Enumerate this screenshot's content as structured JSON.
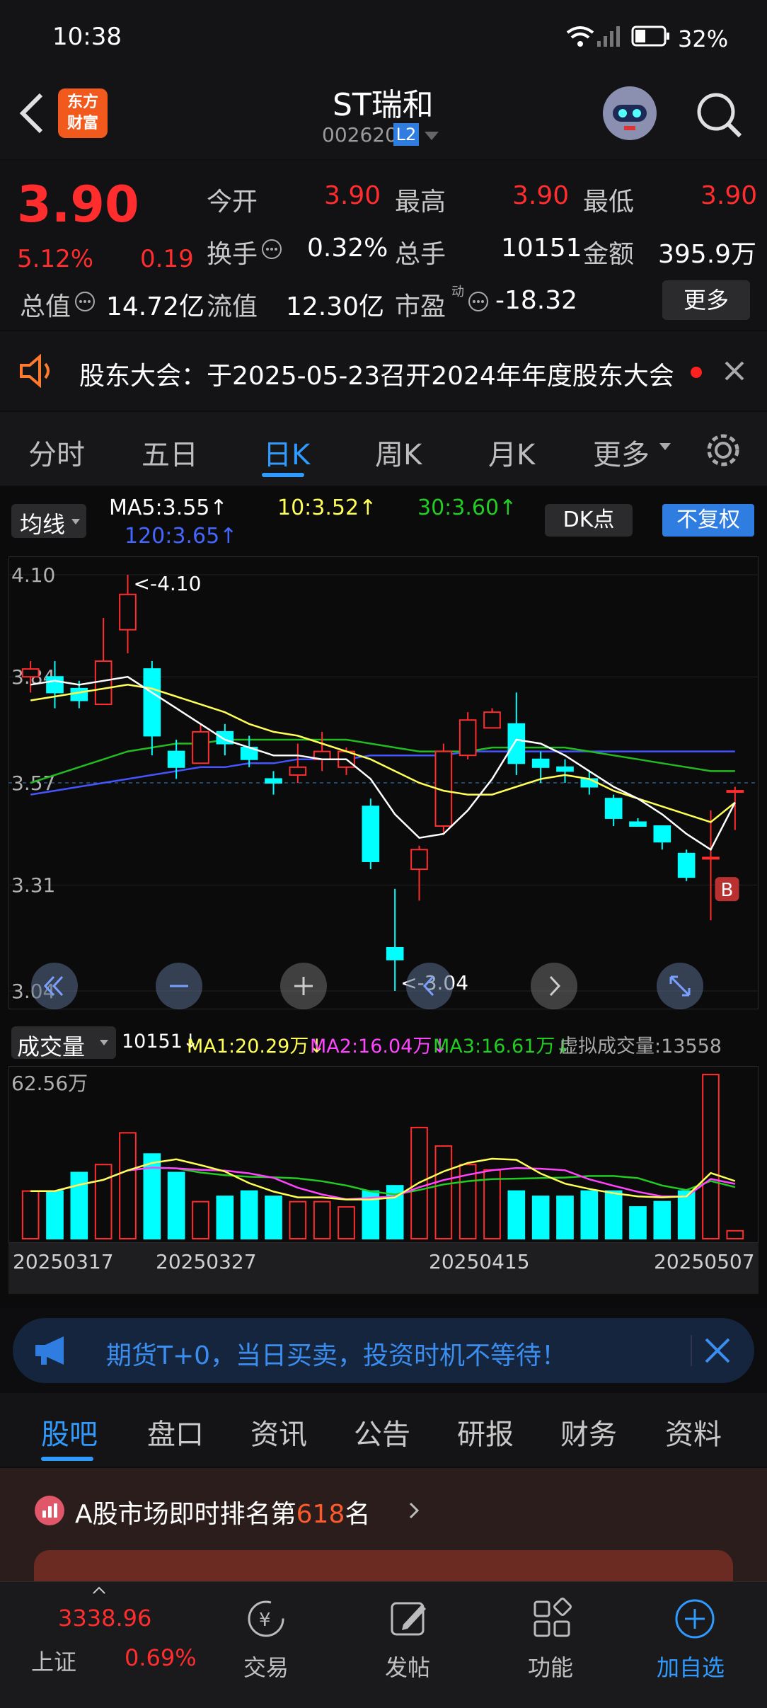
{
  "status": {
    "time": "10:38",
    "battery": "32%"
  },
  "header": {
    "title": "ST瑞和",
    "code": "002620",
    "level": "L2",
    "logo_line1": "东方",
    "logo_line2": "财富"
  },
  "quote": {
    "price": "3.90",
    "change_pct": "5.12%",
    "change_amt": "0.19",
    "open_label": "今开",
    "open": "3.90",
    "high_label": "最高",
    "high": "3.90",
    "low_label": "最低",
    "low": "3.90",
    "turnover_label": "换手",
    "turnover": "0.32%",
    "volume_label": "总手",
    "volume": "10151",
    "amount_label": "金额",
    "amount": "395.9万",
    "mktcap_label": "总值",
    "mktcap": "14.72亿",
    "float_label": "流值",
    "float": "12.30亿",
    "pe_label": "市盈",
    "pe_sup": "动",
    "pe": "-18.32",
    "more_button": "更多"
  },
  "notice": {
    "text": "股东大会：于2025-05-23召开2024年年度股东大会"
  },
  "ktabs": [
    "分时",
    "五日",
    "日K",
    "周K",
    "月K",
    "更多"
  ],
  "ktabs_active": 2,
  "ma_bar": {
    "selector": "均线",
    "ma5": "MA5:3.55↑",
    "ma10": "10:3.52↑",
    "ma30": "30:3.60↑",
    "ma120": "120:3.65↑",
    "dk": "DK点",
    "fq": "不复权"
  },
  "chart_labels": {
    "y_ticks": [
      "4.10",
      "3.84",
      "3.57",
      "3.31",
      "3.04"
    ],
    "high_mark": "<-4.10",
    "low_mark": "<-3.04",
    "b_marker": "B"
  },
  "vol_bar": {
    "selector": "成交量",
    "vol": "10151↓",
    "ma1": "MA1:20.29万↓",
    "ma2": "MA2:16.04万↓",
    "ma3": "MA3:16.61万↓",
    "virtual": "虚拟成交量:13558",
    "top": "62.56万"
  },
  "dates": [
    "20250317",
    "20250327",
    "20250415",
    "20250507"
  ],
  "colors": {
    "up": "#ff2d2d",
    "down": "#00ffff",
    "ma5": "#ffffff",
    "ma10": "#ffff55",
    "ma30": "#22bb22",
    "ma120": "#4455ff",
    "accent": "#2f7de1"
  },
  "chart_data": {
    "type": "candlestick",
    "dates_shown": [
      "20250317",
      "20250327",
      "20250415",
      "20250507"
    ],
    "candles": [
      {
        "o": 3.84,
        "c": 3.86,
        "h": 3.88,
        "l": 3.8
      },
      {
        "o": 3.84,
        "c": 3.8,
        "h": 3.88,
        "l": 3.76
      },
      {
        "o": 3.81,
        "c": 3.78,
        "h": 3.83,
        "l": 3.76
      },
      {
        "o": 3.77,
        "c": 3.88,
        "h": 3.99,
        "l": 3.77
      },
      {
        "o": 3.96,
        "c": 4.05,
        "h": 4.1,
        "l": 3.9
      },
      {
        "o": 3.86,
        "c": 3.69,
        "h": 3.88,
        "l": 3.64
      },
      {
        "o": 3.65,
        "c": 3.61,
        "h": 3.68,
        "l": 3.58
      },
      {
        "o": 3.62,
        "c": 3.7,
        "h": 3.72,
        "l": 3.62
      },
      {
        "o": 3.7,
        "c": 3.67,
        "h": 3.72,
        "l": 3.64
      },
      {
        "o": 3.66,
        "c": 3.63,
        "h": 3.69,
        "l": 3.61
      },
      {
        "o": 3.58,
        "c": 3.57,
        "h": 3.6,
        "l": 3.54
      },
      {
        "o": 3.59,
        "c": 3.61,
        "h": 3.67,
        "l": 3.57
      },
      {
        "o": 3.63,
        "c": 3.65,
        "h": 3.7,
        "l": 3.6
      },
      {
        "o": 3.61,
        "c": 3.65,
        "h": 3.66,
        "l": 3.59
      },
      {
        "o": 3.51,
        "c": 3.37,
        "h": 3.53,
        "l": 3.35
      },
      {
        "o": 3.15,
        "c": 3.12,
        "h": 3.3,
        "l": 3.04
      },
      {
        "o": 3.35,
        "c": 3.4,
        "h": 3.41,
        "l": 3.27
      },
      {
        "o": 3.46,
        "c": 3.65,
        "h": 3.67,
        "l": 3.44
      },
      {
        "o": 3.64,
        "c": 3.73,
        "h": 3.75,
        "l": 3.63
      },
      {
        "o": 3.71,
        "c": 3.75,
        "h": 3.76,
        "l": 3.71
      },
      {
        "o": 3.72,
        "c": 3.62,
        "h": 3.8,
        "l": 3.59
      },
      {
        "o": 3.63,
        "c": 3.61,
        "h": 3.65,
        "l": 3.57
      },
      {
        "o": 3.61,
        "c": 3.6,
        "h": 3.63,
        "l": 3.57
      },
      {
        "o": 3.58,
        "c": 3.56,
        "h": 3.6,
        "l": 3.54
      },
      {
        "o": 3.53,
        "c": 3.48,
        "h": 3.54,
        "l": 3.46
      },
      {
        "o": 3.47,
        "c": 3.46,
        "h": 3.48,
        "l": 3.46
      },
      {
        "o": 3.46,
        "c": 3.42,
        "h": 3.46,
        "l": 3.4
      },
      {
        "o": 3.39,
        "c": 3.33,
        "h": 3.4,
        "l": 3.32
      },
      {
        "o": 3.38,
        "c": 3.38,
        "h": 3.5,
        "l": 3.22
      },
      {
        "o": 3.55,
        "c": 3.55,
        "h": 3.56,
        "l": 3.45
      }
    ],
    "ma5": [
      3.82,
      3.83,
      3.82,
      3.83,
      3.84,
      3.8,
      3.76,
      3.72,
      3.68,
      3.66,
      3.64,
      3.64,
      3.63,
      3.63,
      3.58,
      3.49,
      3.43,
      3.44,
      3.5,
      3.58,
      3.68,
      3.67,
      3.64,
      3.6,
      3.56,
      3.53,
      3.49,
      3.44,
      3.4,
      3.52
    ],
    "ma10": [
      3.78,
      3.79,
      3.8,
      3.81,
      3.82,
      3.81,
      3.79,
      3.77,
      3.75,
      3.72,
      3.7,
      3.69,
      3.67,
      3.65,
      3.63,
      3.6,
      3.57,
      3.55,
      3.54,
      3.54,
      3.56,
      3.58,
      3.59,
      3.58,
      3.55,
      3.53,
      3.51,
      3.49,
      3.47,
      3.52
    ],
    "ma30": [
      3.57,
      3.59,
      3.61,
      3.63,
      3.65,
      3.66,
      3.67,
      3.67,
      3.68,
      3.68,
      3.68,
      3.68,
      3.68,
      3.68,
      3.67,
      3.66,
      3.65,
      3.65,
      3.65,
      3.66,
      3.66,
      3.66,
      3.66,
      3.65,
      3.64,
      3.63,
      3.62,
      3.61,
      3.6,
      3.6
    ],
    "ma120": [
      3.54,
      3.55,
      3.56,
      3.57,
      3.58,
      3.59,
      3.6,
      3.61,
      3.61,
      3.62,
      3.62,
      3.63,
      3.63,
      3.63,
      3.64,
      3.64,
      3.64,
      3.64,
      3.65,
      3.65,
      3.65,
      3.65,
      3.65,
      3.65,
      3.65,
      3.65,
      3.65,
      3.65,
      3.65,
      3.65
    ],
    "volume": [
      18,
      18,
      25,
      28,
      40,
      32,
      25,
      14,
      16,
      18,
      16,
      14,
      14,
      12,
      18,
      20,
      42,
      35,
      28,
      26,
      18,
      16,
      16,
      18,
      18,
      12,
      14,
      18,
      62,
      3
    ],
    "vol_up": [
      true,
      false,
      false,
      true,
      true,
      false,
      false,
      true,
      false,
      false,
      false,
      true,
      true,
      true,
      false,
      false,
      true,
      true,
      true,
      true,
      false,
      false,
      false,
      false,
      false,
      false,
      false,
      false,
      true,
      true
    ],
    "ylim": [
      3.04,
      4.1
    ],
    "vol_max": 62.56
  },
  "banner": {
    "text": "期货T+0，当日买卖，投资时机不等待！"
  },
  "btabs": [
    "股吧",
    "盘口",
    "资讯",
    "公告",
    "研报",
    "财务",
    "资料"
  ],
  "btabs_active": 0,
  "rank": {
    "prefix": "A股市场即时排名第",
    "num": "618",
    "suffix": "名"
  },
  "bottomnav": {
    "index_value": "3338.96",
    "index_name": "上证",
    "index_pct": "0.69%",
    "trade": "交易",
    "post": "发帖",
    "func": "功能",
    "add": "加自选"
  }
}
